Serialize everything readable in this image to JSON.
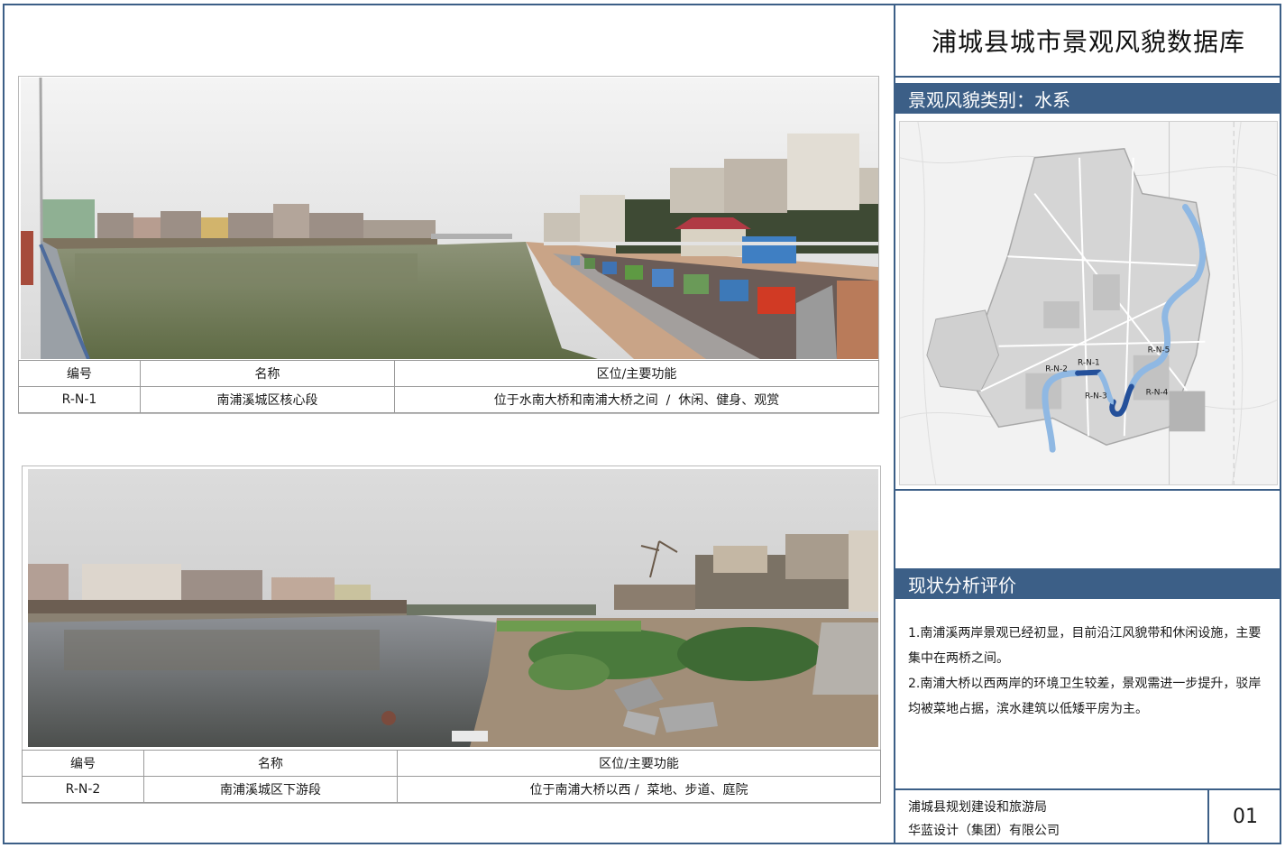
{
  "header": {
    "title": "浦城县城市景观风貌数据库"
  },
  "category": {
    "label": "景观风貌类别：水系"
  },
  "map": {
    "labels": [
      "R-N-1",
      "R-N-2",
      "R-N-3",
      "R-N-4",
      "R-N-5"
    ]
  },
  "records": [
    {
      "headers": [
        "编号",
        "名称",
        "区位/主要功能"
      ],
      "id": "R-N-1",
      "name": "南浦溪城区核心段",
      "function": "位于水南大桥和南浦大桥之间  /  休闲、健身、观赏"
    },
    {
      "headers": [
        "编号",
        "名称",
        "区位/主要功能"
      ],
      "id": "R-N-2",
      "name": "南浦溪城区下游段",
      "function": "位于南浦大桥以西 /  菜地、步道、庭院"
    }
  ],
  "analysis": {
    "title": "现状分析评价",
    "p1": "1.南浦溪两岸景观已经初显，目前沿江风貌带和休闲设施，主要集中在两桥之间。",
    "p2": "2.南浦大桥以西两岸的环境卫生较差，景观需进一步提升，驳岸均被菜地占据，滨水建筑以低矮平房为主。"
  },
  "footer": {
    "org1": "浦城县规划建设和旅游局",
    "org2": "华蓝设计（集团）有限公司",
    "page": "01"
  },
  "colors": {
    "accent": "#3c5f87",
    "river_light": "#8fb8e3",
    "river_dark": "#24509a"
  }
}
